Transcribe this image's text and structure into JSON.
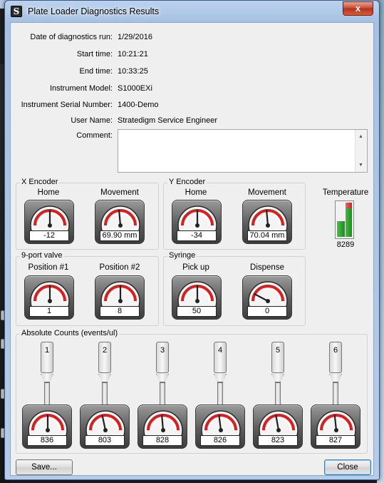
{
  "window": {
    "title": "Plate Loader Diagnostics Results",
    "close_glyph": "x"
  },
  "info": [
    {
      "label": "Date of diagnostics run:",
      "value": "1/29/2016"
    },
    {
      "label": "Start time:",
      "value": "10:21:21"
    },
    {
      "label": "End time:",
      "value": "10:33:25"
    },
    {
      "label": "Instrument Model:",
      "value": "S1000EXi"
    },
    {
      "label": "Instrument Serial Number:",
      "value": "1400-Demo"
    },
    {
      "label": "User Name:",
      "value": "Stratedigm Service Engineer"
    },
    {
      "label": "Comment:",
      "value": ""
    }
  ],
  "x_encoder": {
    "title": "X Encoder",
    "home": {
      "label": "Home",
      "readout": "-12",
      "needle_deg": 0
    },
    "movement": {
      "label": "Movement",
      "readout": "69.90 mm",
      "needle_deg": -5
    }
  },
  "y_encoder": {
    "title": "Y Encoder",
    "home": {
      "label": "Home",
      "readout": "-34",
      "needle_deg": 0
    },
    "movement": {
      "label": "Movement",
      "readout": "70.04 mm",
      "needle_deg": -5
    }
  },
  "temperature": {
    "label": "Temperature",
    "value": "8289",
    "colors": {
      "green": "#2fa52f",
      "red": "#e23b3b"
    }
  },
  "valve": {
    "title": "9-port valve",
    "pos1": {
      "label": "Position #1",
      "readout": "1",
      "needle_deg": 0
    },
    "pos2": {
      "label": "Position #2",
      "readout": "8",
      "needle_deg": 0
    }
  },
  "syringe": {
    "title": "Syringe",
    "pickup": {
      "label": "Pick up",
      "readout": "50",
      "needle_deg": 0
    },
    "dispense": {
      "label": "Dispense",
      "readout": "0",
      "needle_deg": -62
    }
  },
  "absolute_counts": {
    "title": "Absolute Counts (events/ul)",
    "probes": [
      {
        "label": "1",
        "readout": "836",
        "needle_deg": 0
      },
      {
        "label": "2",
        "readout": "803",
        "needle_deg": -12
      },
      {
        "label": "3",
        "readout": "828",
        "needle_deg": -5
      },
      {
        "label": "4",
        "readout": "826",
        "needle_deg": -7
      },
      {
        "label": "5",
        "readout": "823",
        "needle_deg": -10
      },
      {
        "label": "6",
        "readout": "827",
        "needle_deg": -6
      }
    ]
  },
  "buttons": {
    "save": "Save...",
    "close": "Close"
  },
  "colors": {
    "gauge_red": "#d42020",
    "default_button_border": "#3c7fb1"
  }
}
